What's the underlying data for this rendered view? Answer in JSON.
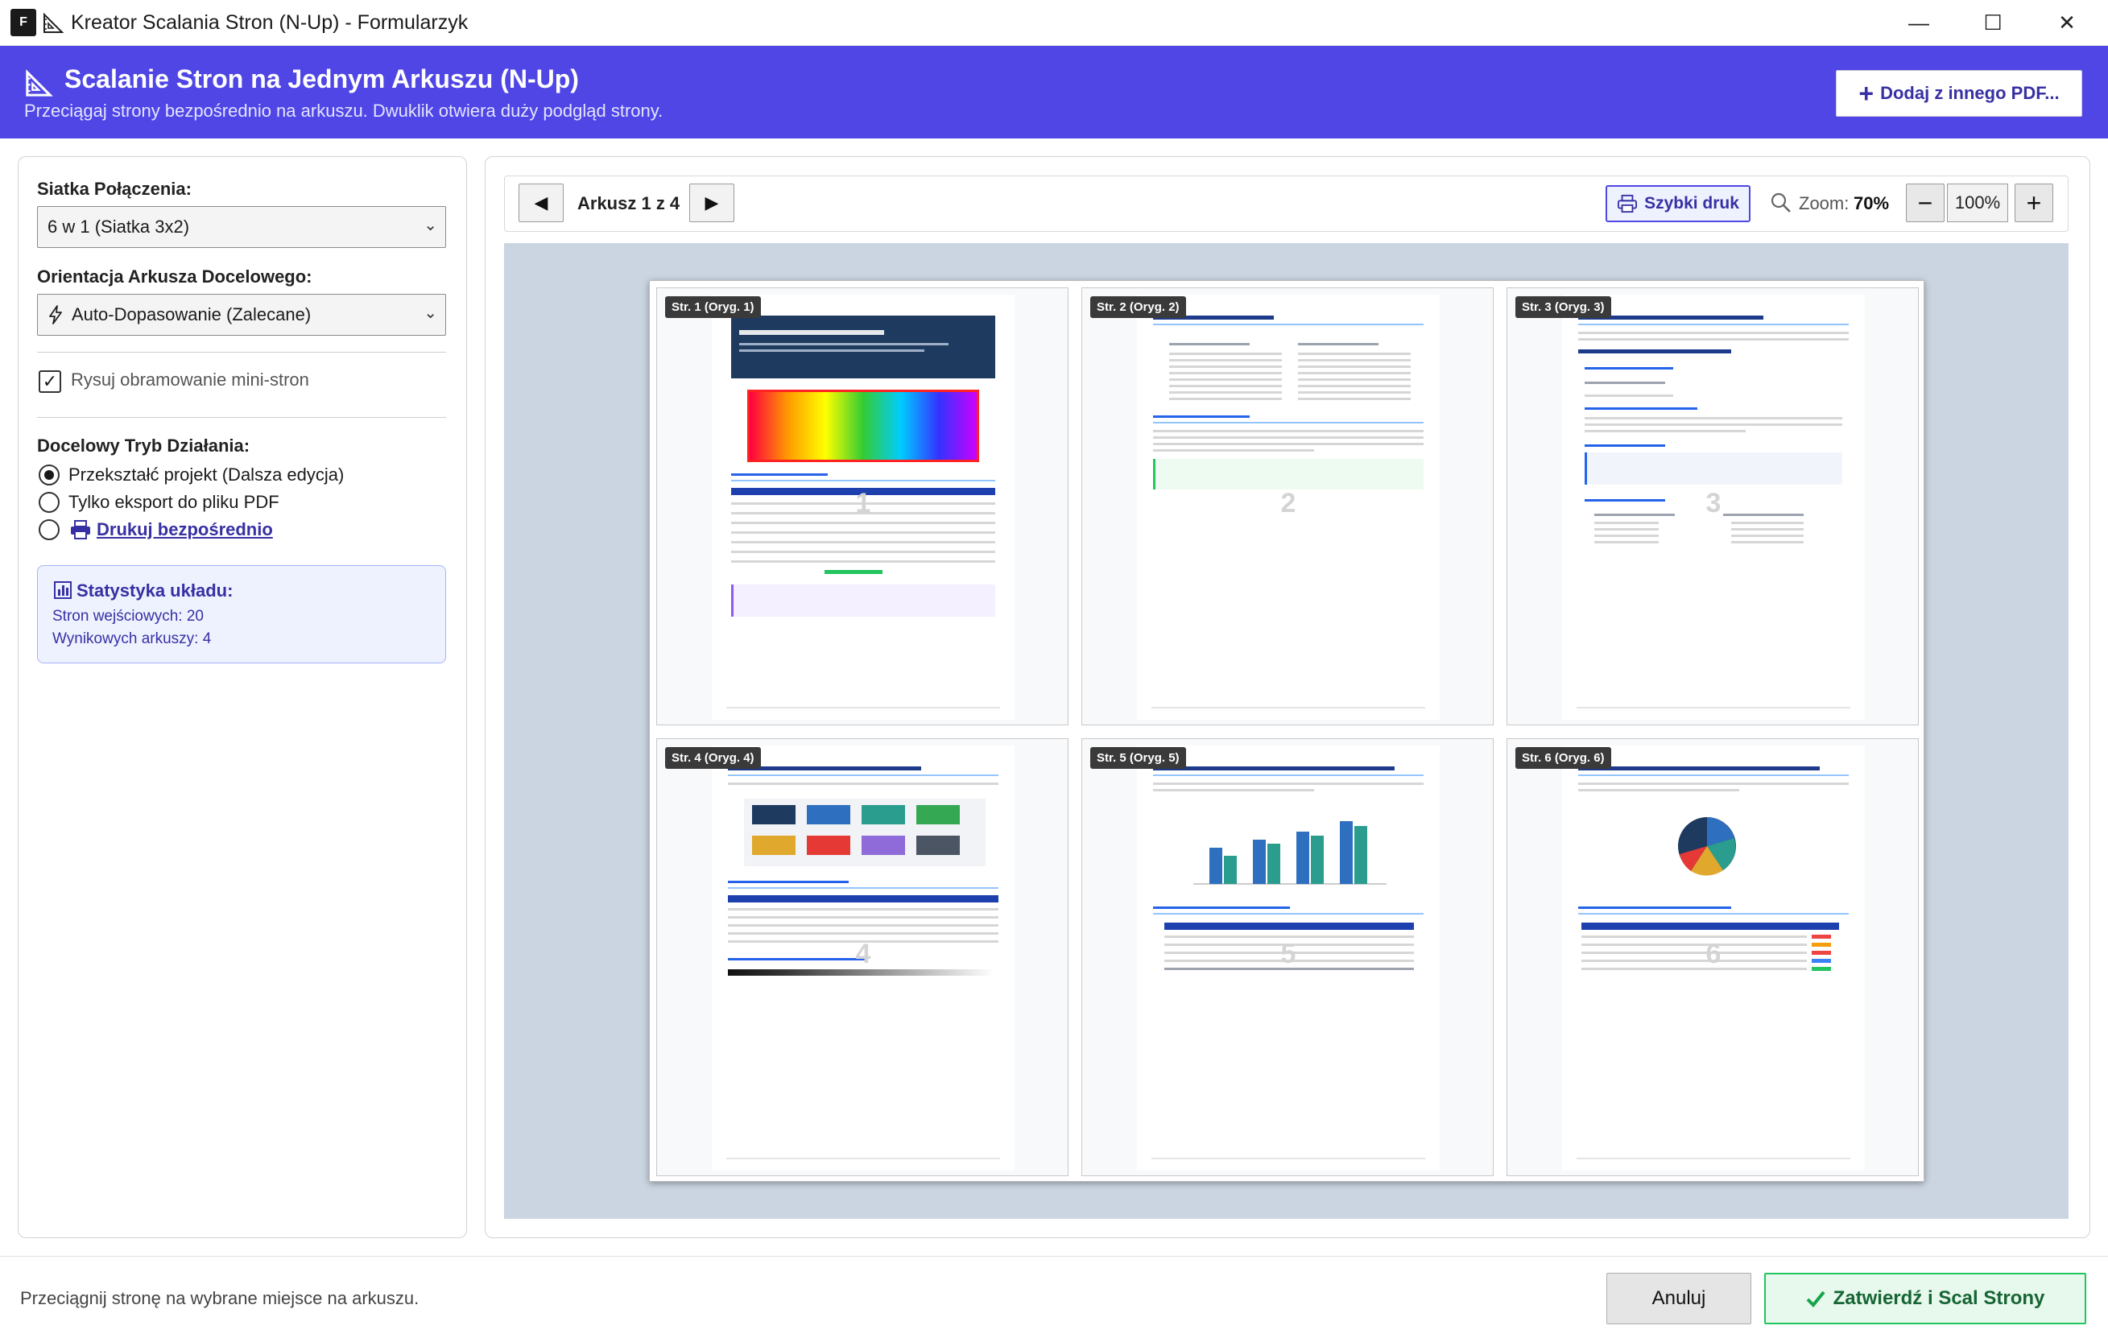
{
  "window": {
    "app_icon_letter": "F",
    "title": "Kreator Scalania Stron (N-Up) - Formularzyk",
    "minimize": "—",
    "maximize": "☐",
    "close": "✕"
  },
  "header": {
    "title": "Scalanie Stron na Jednym Arkuszu (N-Up)",
    "subtitle": "Przeciągaj strony bezpośrednio na arkuszu. Dwuklik otwiera duży podgląd strony.",
    "add_button": "Dodaj z innego PDF..."
  },
  "sidebar": {
    "grid_label": "Siatka Połączenia:",
    "grid_value": "6 w 1 (Siatka 3x2)",
    "orientation_label": "Orientacja Arkusza Docelowego:",
    "orientation_value": "Auto-Dopasowanie (Zalecane)",
    "draw_border_label": "Rysuj obramowanie mini-stron",
    "draw_border_checked": true,
    "mode_label": "Docelowy Tryb Działania:",
    "modes": [
      {
        "label": "Przekształć projekt (Dalsza edycja)",
        "selected": true
      },
      {
        "label": "Tylko eksport do pliku PDF",
        "selected": false
      },
      {
        "label": "Drukuj bezpośrednio",
        "selected": false
      }
    ],
    "stats": {
      "title": "Statystyka układu:",
      "input_pages": "Stron wejściowych: 20",
      "output_sheets": "Wynikowych arkuszy: 4"
    }
  },
  "toolbar": {
    "prev_icon": "◀",
    "next_icon": "▶",
    "sheet_label": "Arkusz 1 z 4",
    "quick_print": "Szybki druk",
    "zoom_label": "Zoom:",
    "zoom_value": "70%",
    "zoom_out": "−",
    "zoom_reset": "100%",
    "zoom_in": "+"
  },
  "pages": [
    {
      "caption": "Str. 1 (Oryg. 1)",
      "number": "1"
    },
    {
      "caption": "Str. 2 (Oryg. 2)",
      "number": "2"
    },
    {
      "caption": "Str. 3 (Oryg. 3)",
      "number": "3"
    },
    {
      "caption": "Str. 4 (Oryg. 4)",
      "number": "4"
    },
    {
      "caption": "Str. 5 (Oryg. 5)",
      "number": "5"
    },
    {
      "caption": "Str. 6 (Oryg. 6)",
      "number": "6"
    }
  ],
  "footer": {
    "status": "Przeciągnij stronę na wybrane miejsce na arkuszu.",
    "cancel": "Anuluj",
    "confirm": "Zatwierdź i Scal Strony"
  },
  "colors": {
    "accent": "#4f46e5",
    "accent_dark": "#3730a3",
    "confirm_green": "#22c55e"
  }
}
